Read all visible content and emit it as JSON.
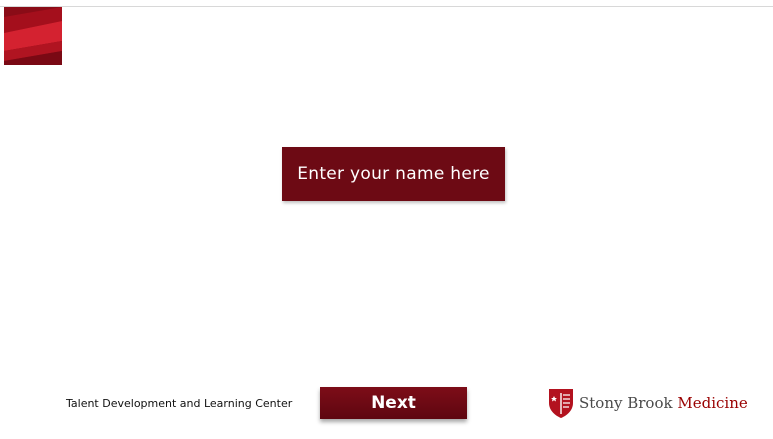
{
  "name_entry": {
    "label": "Enter your name here"
  },
  "footer": {
    "org_name": "Talent Development and Learning Center",
    "next_label": "Next",
    "brand": {
      "primary": "Stony Brook",
      "secondary": "Medicine"
    }
  },
  "colors": {
    "accent": "#6d0a14",
    "brand_red": "#990000"
  },
  "icons": {
    "corner": "red-stripes-graphic",
    "brand": "stony-brook-shield-logo"
  }
}
